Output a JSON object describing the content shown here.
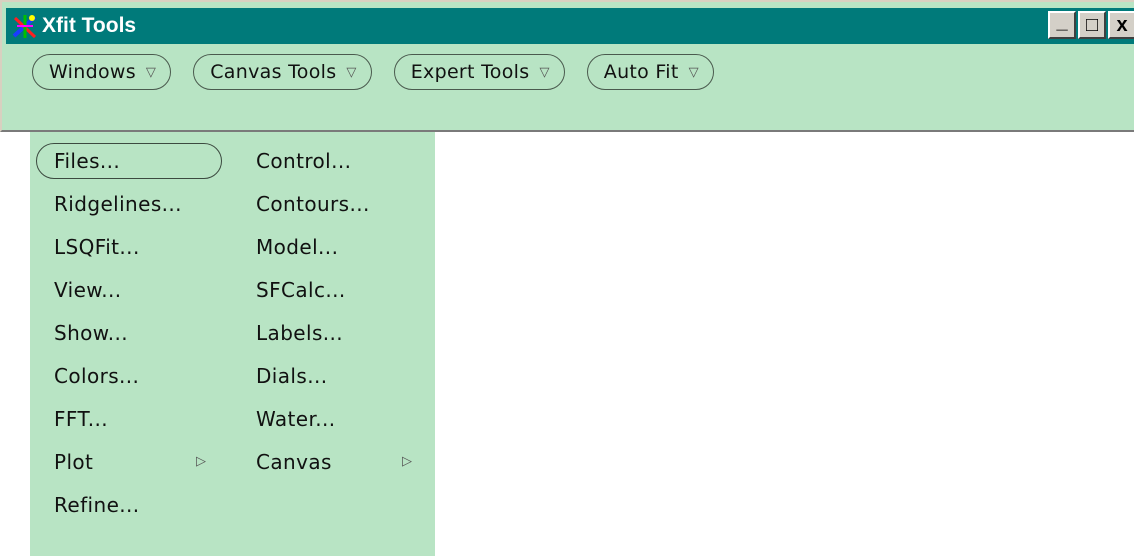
{
  "window": {
    "title": "Xfit Tools",
    "controls": {
      "minimize": "_",
      "maximize": "□",
      "close": "x"
    }
  },
  "menubar": [
    {
      "label": "Windows",
      "arrow": "▽"
    },
    {
      "label": "Canvas Tools",
      "arrow": "▽"
    },
    {
      "label": "Expert Tools",
      "arrow": "▽"
    },
    {
      "label": "Auto Fit",
      "arrow": "▽"
    }
  ],
  "dropdown": {
    "left_column": [
      "Files...",
      "Ridgelines...",
      "LSQFit...",
      "View...",
      "Show...",
      "Colors...",
      "FFT...",
      "Plot",
      "Refine..."
    ],
    "right_column": [
      "Control...",
      "Contours...",
      "Model...",
      "SFCalc...",
      "Labels...",
      "Dials...",
      "Water...",
      "Canvas"
    ],
    "submenu_arrow": "▷",
    "highlighted_item": "Files..."
  },
  "colors": {
    "titlebar": "#007a7a",
    "panel": "#b8e4c4",
    "title_text": "#ffffff"
  }
}
